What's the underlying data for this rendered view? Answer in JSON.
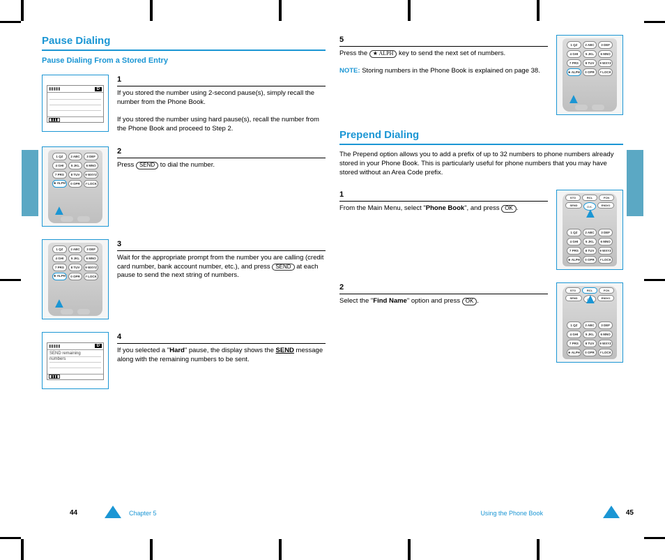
{
  "crop": {},
  "left_page": {
    "title": "Pause Dialing",
    "subtitle": "Pause Dialing From a Stored Entry",
    "steps": [
      {
        "num": "1",
        "text_a": "If you stored the number using 2-second pause(s), simply recall the number from the Phone Book.",
        "text_b": "If you stored the number using hard pause(s), recall the number from the Phone Book and proceed to Step 2."
      },
      {
        "num": "2",
        "text_a": "Press ",
        "key": "SEND",
        "text_b": " to dial the number."
      },
      {
        "num": "3",
        "text_a": "Wait for the appropriate prompt from the number you are calling (credit card number, bank account number, etc.), and press ",
        "key": "SEND",
        "text_b": " at each pause to send the next string of numbers."
      },
      {
        "num": "4",
        "text_a": "If you selected a \"",
        "hard": "Hard",
        "text_b": "\" pause, the display shows the ",
        "send_word": "SEND",
        "text_c": " message along with the remaining numbers to be sent."
      }
    ],
    "page_num": "44",
    "chap": "Chapter 5"
  },
  "right_page": {
    "step5": {
      "num": "5",
      "text_a": "Press the ",
      "star_key": "★ ALPH",
      "text_b": " key to send the next set of numbers."
    },
    "note_label": "NOTE:",
    "note_text": "Storing numbers in the Phone Book is explained on page 38.",
    "title": "Prepend Dialing",
    "intro": "The Prepend option allows you to add a prefix of up to 32 numbers to phone numbers already stored in your Phone Book. This is particularly useful for phone numbers that you may have stored without an Area Code prefix.",
    "step1": {
      "num": "1",
      "text_a": "From the Main Menu, select \"",
      "pb": "Phone Book",
      "text_b": "\", and press ",
      "ok": "OK",
      "text_c": "."
    },
    "step2": {
      "num": "2",
      "text_a": "Select the \"",
      "find": "Find Name",
      "text_b": "\" option and press ",
      "ok": "OK",
      "text_c": "."
    },
    "page_num": "45",
    "chap": "Using the Phone Book"
  },
  "screens": {
    "s1_lines": [
      "",
      "",
      ""
    ],
    "s4_line1": "SEND remaining",
    "s4_line2": "numbers"
  },
  "keypad": {
    "k1": "1 QZ",
    "k2": "2 ABC",
    "k3": "3 DEF",
    "k4": "4 GHI",
    "k5": "5 JKL",
    "k6": "6 MNO",
    "k7": "7 PRS",
    "k8": "8 TUV",
    "k9": "9 WXYZ",
    "kstar": "★ ALPH",
    "k0": "0 OPR",
    "khash": "# LOCK",
    "sto": "STO",
    "rcl": "RCL",
    "fcn": "FCN",
    "send": "SEND",
    "ok": "O.K.",
    "end": "END/O"
  }
}
